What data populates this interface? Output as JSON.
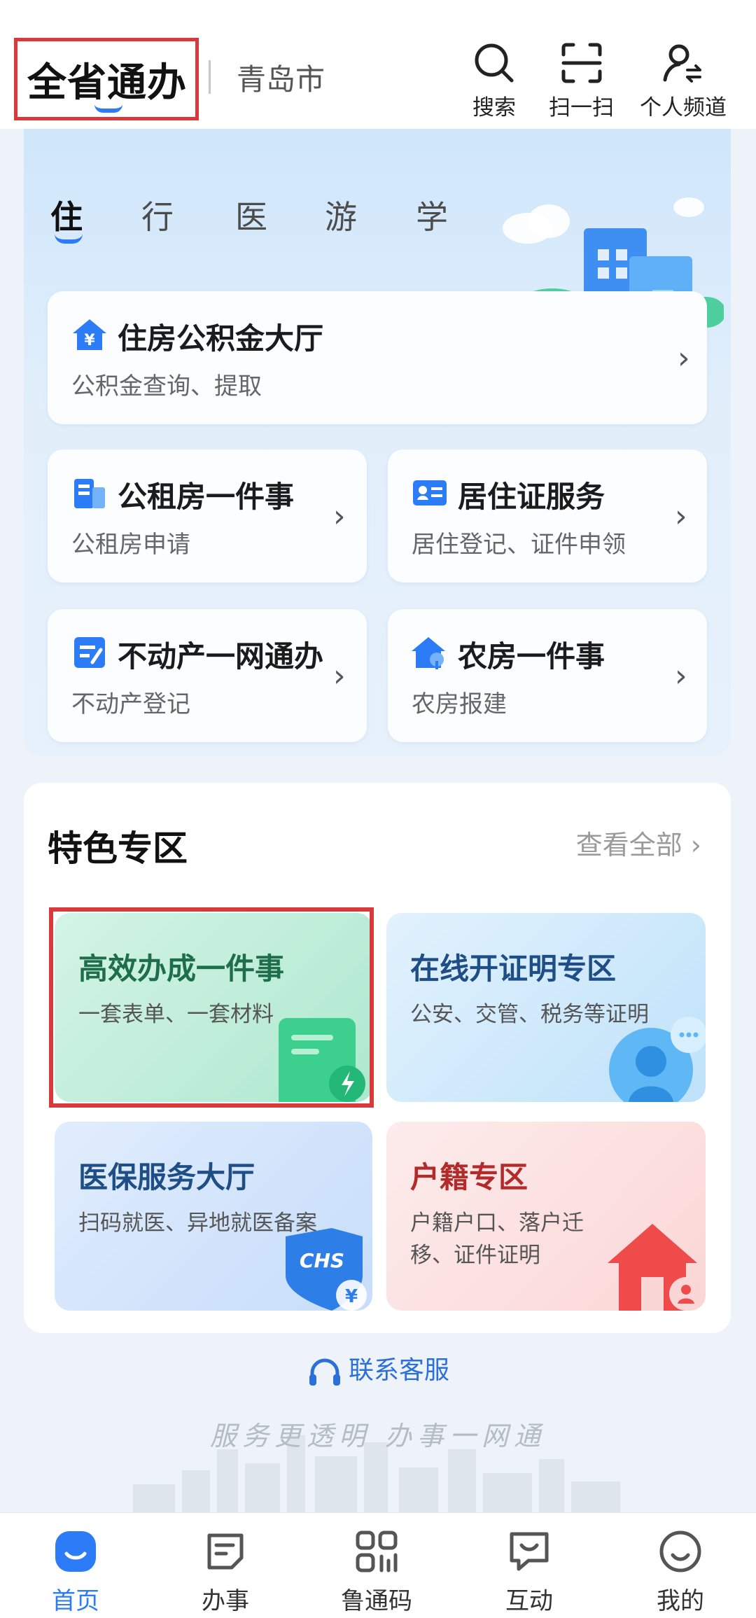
{
  "header": {
    "app_title": "全省通办",
    "city": "青岛市",
    "actions": [
      {
        "label": "搜索",
        "icon": "search-icon"
      },
      {
        "label": "扫一扫",
        "icon": "scan-icon"
      },
      {
        "label": "个人频道",
        "icon": "personal-channel-icon"
      }
    ]
  },
  "life_tabs": {
    "items": [
      "住",
      "行",
      "医",
      "游",
      "学"
    ],
    "active": "住"
  },
  "services": [
    {
      "title": "住房公积金大厅",
      "subtitle": "公积金查询、提取",
      "icon": "housing-fund-icon"
    },
    {
      "title": "公租房一件事",
      "subtitle": "公租房申请",
      "icon": "public-rental-icon"
    },
    {
      "title": "居住证服务",
      "subtitle": "居住登记、证件申领",
      "icon": "residence-permit-icon"
    },
    {
      "title": "不动产一网通办",
      "subtitle": "不动产登记",
      "icon": "real-estate-icon"
    },
    {
      "title": "农房一件事",
      "subtitle": "农房报建",
      "icon": "rural-house-icon"
    }
  ],
  "featured": {
    "title": "特色专区",
    "more_label": "查看全部",
    "cards": [
      {
        "title": "高效办成一件事",
        "subtitle": "一套表单、一套材料",
        "icon": "document-bolt-icon"
      },
      {
        "title": "在线开证明专区",
        "subtitle": "公安、交管、税务等证明",
        "icon": "person-chat-icon"
      },
      {
        "title": "医保服务大厅",
        "subtitle": "扫码就医、异地就医备案",
        "icon": "chs-shield-icon",
        "badge": "CHS"
      },
      {
        "title": "户籍专区",
        "subtitle": "户籍户口、落户迁移、证件证明",
        "icon": "house-person-icon"
      }
    ]
  },
  "contact_label": "联系客服",
  "slogan": "服务更透明 办事一网通",
  "bottom_nav": {
    "items": [
      {
        "label": "首页",
        "icon": "home-icon"
      },
      {
        "label": "办事",
        "icon": "tasks-icon"
      },
      {
        "label": "鲁通码",
        "icon": "qr-code-icon"
      },
      {
        "label": "互动",
        "icon": "interaction-icon"
      },
      {
        "label": "我的",
        "icon": "profile-icon"
      }
    ],
    "active": "首页"
  },
  "colors": {
    "accent": "#2b7cf6",
    "highlight_border": "#d9393b",
    "card_green": "#b9ecd6",
    "card_blue": "#cfe9fb",
    "card_medical": "#d5e6fb",
    "card_red": "#fde3e3",
    "title_green": "#1e6e4b",
    "title_blue": "#1f4d86",
    "title_red": "#b32a2a"
  }
}
